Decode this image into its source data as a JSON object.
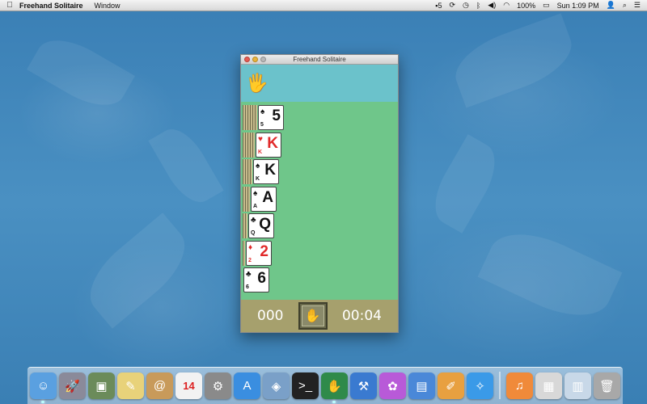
{
  "menubar": {
    "apple_icon": "apple-icon",
    "app_name": "Freehand Solitaire",
    "menus": [
      "Window"
    ],
    "status": {
      "badge_number": "5",
      "battery": "100%",
      "clock": "Sun 1:09 PM"
    }
  },
  "window": {
    "title": "Freehand Solitaire",
    "score": "000",
    "timer": "00:04",
    "tableau": [
      {
        "rank": "5",
        "suit": "♠",
        "color": "black",
        "hidden": 6
      },
      {
        "rank": "K",
        "suit": "♥",
        "color": "red",
        "hidden": 5
      },
      {
        "rank": "K",
        "suit": "♠",
        "color": "black",
        "hidden": 4
      },
      {
        "rank": "A",
        "suit": "♠",
        "color": "black",
        "hidden": 3
      },
      {
        "rank": "Q",
        "suit": "♣",
        "color": "black",
        "hidden": 2
      },
      {
        "rank": "2",
        "suit": "♦",
        "color": "red",
        "hidden": 1
      },
      {
        "rank": "6",
        "suit": "♣",
        "color": "black",
        "hidden": 0
      }
    ]
  },
  "colors": {
    "felt": "#6fc68a",
    "top_area": "#6bc2cb",
    "bottom_bar": "#a6a06d"
  },
  "dock": {
    "calendar_day": "14",
    "items": [
      {
        "name": "finder",
        "icon": "finder-icon",
        "bg": "#5aa0e0",
        "glyph": "☺",
        "running": true
      },
      {
        "name": "launchpad",
        "icon": "rocket-icon",
        "bg": "#8a8a9a",
        "glyph": "🚀",
        "running": false
      },
      {
        "name": "photos",
        "icon": "photo-icon",
        "bg": "#6b8b5a",
        "glyph": "▣",
        "running": false
      },
      {
        "name": "stickies",
        "icon": "notes-icon",
        "bg": "#e8d27a",
        "glyph": "✎",
        "running": false
      },
      {
        "name": "address-book",
        "icon": "address-book-icon",
        "bg": "#c89a5a",
        "glyph": "@",
        "running": false
      },
      {
        "name": "calendar",
        "icon": "calendar-icon",
        "bg": "#f2f2f2",
        "glyph": "",
        "running": false
      },
      {
        "name": "system-preferences",
        "icon": "gear-icon",
        "bg": "#8a8a8a",
        "glyph": "⚙",
        "running": false
      },
      {
        "name": "app-store",
        "icon": "app-store-icon",
        "bg": "#3a8ee0",
        "glyph": "A",
        "running": false
      },
      {
        "name": "preview",
        "icon": "preview-icon",
        "bg": "#7aa0c8",
        "glyph": "◈",
        "running": false
      },
      {
        "name": "terminal",
        "icon": "terminal-icon",
        "bg": "#222",
        "glyph": ">_",
        "running": false
      },
      {
        "name": "freehand-solitaire",
        "icon": "hand-icon",
        "bg": "#2f8a4a",
        "glyph": "✋",
        "running": true
      },
      {
        "name": "xcode",
        "icon": "xcode-icon",
        "bg": "#3a7ad0",
        "glyph": "⚒",
        "running": false
      },
      {
        "name": "flower",
        "icon": "flower-icon",
        "bg": "#b85ad8",
        "glyph": "✿",
        "running": false
      },
      {
        "name": "keynote",
        "icon": "keynote-icon",
        "bg": "#4a88d8",
        "glyph": "▤",
        "running": false
      },
      {
        "name": "pages",
        "icon": "pages-icon",
        "bg": "#e8a040",
        "glyph": "✐",
        "running": false
      },
      {
        "name": "safari",
        "icon": "compass-icon",
        "bg": "#3a9ae8",
        "glyph": "✧",
        "running": false
      },
      {
        "name": "itunes",
        "icon": "music-icon",
        "bg": "#f08a3a",
        "glyph": "♫",
        "running": false
      },
      {
        "name": "downloads",
        "icon": "download-stack-icon",
        "bg": "#d8d8d8",
        "glyph": "▦",
        "running": false
      },
      {
        "name": "documents",
        "icon": "documents-icon",
        "bg": "#c8d8e8",
        "glyph": "▥",
        "running": false
      },
      {
        "name": "trash",
        "icon": "trash-icon",
        "bg": "#a8a8a8",
        "glyph": "🗑",
        "running": false
      }
    ]
  }
}
